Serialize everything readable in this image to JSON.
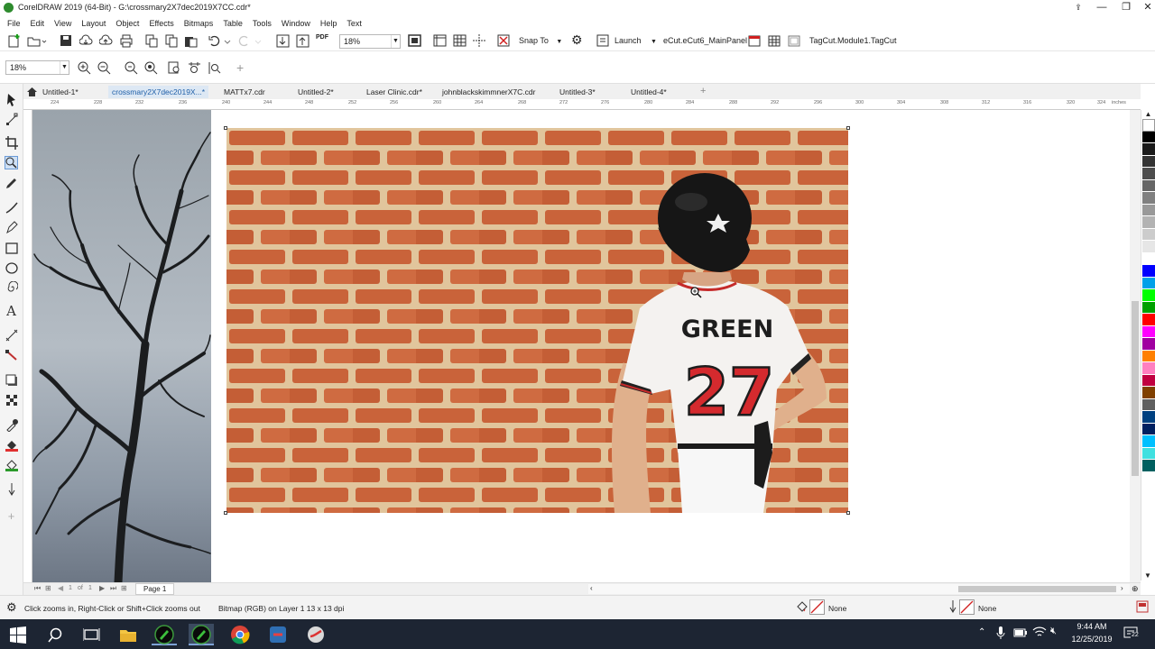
{
  "window": {
    "title": "CorelDRAW 2019 (64-Bit) - G:\\crossmary2X7dec2019X7CC.cdr*",
    "controls": [
      "—",
      "❐",
      "✕"
    ]
  },
  "menu": [
    "File",
    "Edit",
    "View",
    "Layout",
    "Object",
    "Effects",
    "Bitmaps",
    "Table",
    "Tools",
    "Window",
    "Help",
    "Text"
  ],
  "toolbar": {
    "zoom_value": "18%",
    "pdf_label": "PDF",
    "snap_to": "Snap To",
    "launch": "Launch",
    "macro1": "eCut.eCut6_MainPanel",
    "macro2": "TagCut.Module1.TagCut"
  },
  "property_bar": {
    "zoom_value": "18%"
  },
  "tabs": [
    {
      "label": "Untitled-1*"
    },
    {
      "label": "crossmary2X7dec2019X...*",
      "active": true
    },
    {
      "label": "MATTx7.cdr"
    },
    {
      "label": "Untitled-2*"
    },
    {
      "label": "Laser Clinic.cdr*"
    },
    {
      "label": "johnblackskimmnerX7C.cdr"
    },
    {
      "label": "Untitled-3*"
    },
    {
      "label": "Untitled-4*"
    }
  ],
  "ruler": {
    "labels": [
      "224",
      "228",
      "232",
      "236",
      "240",
      "244",
      "248",
      "252",
      "256",
      "260",
      "264",
      "268",
      "272",
      "276",
      "280",
      "284",
      "288",
      "292",
      "296",
      "300",
      "304",
      "308",
      "312",
      "316",
      "320",
      "324"
    ],
    "unit": "inches"
  },
  "canvas": {
    "jersey_name": "GREEN",
    "jersey_number": "27"
  },
  "page_nav": {
    "counter_a": "1",
    "counter_of": "of",
    "counter_b": "1",
    "page_label": "Page 1"
  },
  "status": {
    "hint": "Click zooms in, Right-Click or Shift+Click zooms out",
    "object_info": "Bitmap (RGB) on Layer 1 13 x 13 dpi",
    "fill": "None",
    "outline": "None"
  },
  "taskbar": {
    "time": "9:44 AM",
    "date": "12/25/2019",
    "notif_count": "22"
  },
  "palette_colors": [
    "#ffffff",
    "#000000",
    "#1a1a1a",
    "#333333",
    "#4d4d4d",
    "#666666",
    "#808080",
    "#999999",
    "#b3b3b3",
    "#cccccc",
    "#e6e6e6",
    "#ffffff",
    "#0000ff",
    "#00a0e9",
    "#00ff00",
    "#00a000",
    "#ff0000",
    "#ff00ff",
    "#a000a0",
    "#ff8000",
    "#ff80c0",
    "#c00040",
    "#804000",
    "#606060",
    "#004080",
    "#002060",
    "#00c0ff",
    "#40e0e0",
    "#006060"
  ]
}
